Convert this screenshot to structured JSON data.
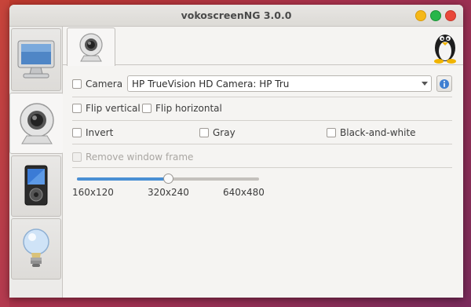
{
  "window": {
    "title": "vokoscreenNG 3.0.0"
  },
  "side_tabs": [
    {
      "name": "screencast",
      "icon": "monitor-icon"
    },
    {
      "name": "camera",
      "icon": "webcam-icon"
    },
    {
      "name": "player",
      "icon": "media-player-icon"
    },
    {
      "name": "about",
      "icon": "lightbulb-icon"
    }
  ],
  "camera_panel": {
    "camera_label": "Camera",
    "camera_selected": "HP TrueVision HD Camera: HP Tru",
    "flip_vertical": "Flip vertical",
    "flip_horizontal": "Flip horizontal",
    "invert": "Invert",
    "gray": "Gray",
    "black_and_white": "Black-and-white",
    "remove_window_frame": "Remove window frame",
    "size_slider": {
      "labels": [
        "160x120",
        "320x240",
        "640x480"
      ],
      "selected_index": 1
    }
  },
  "colors": {
    "accent": "#4a8fd4",
    "close": "#e9483a",
    "maximize": "#27b64a",
    "minimize": "#f5b818"
  }
}
